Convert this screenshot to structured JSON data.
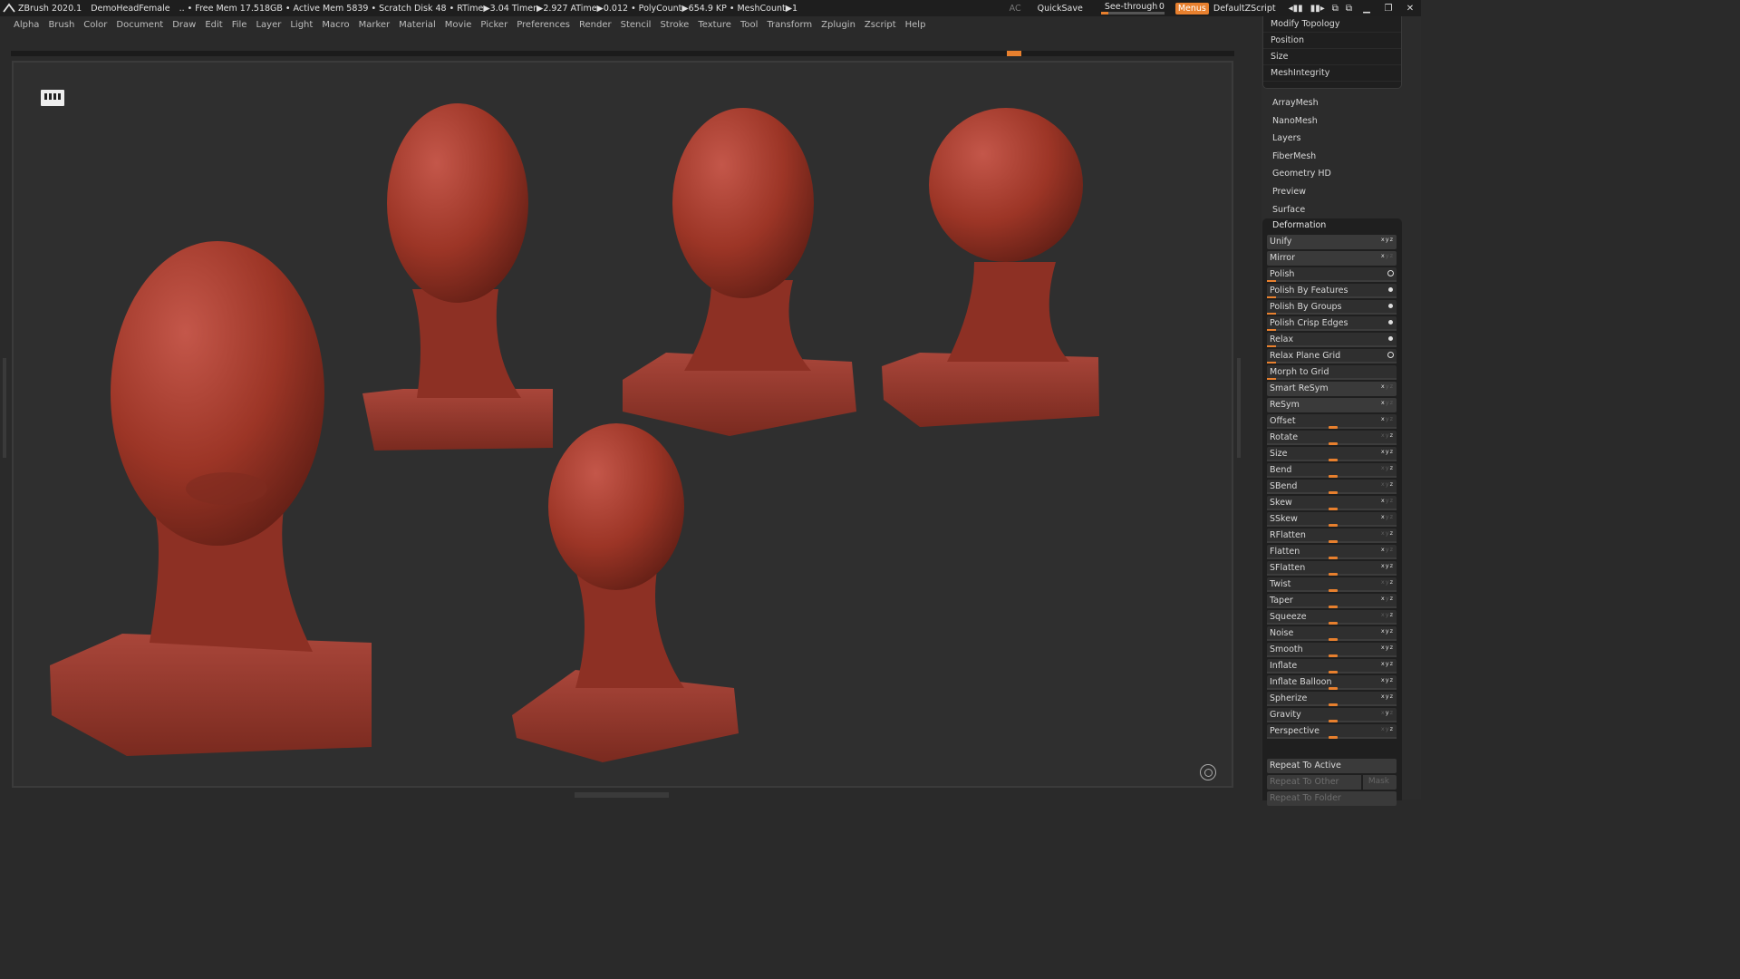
{
  "titlebar": {
    "app_name": "ZBrush 2020.1",
    "document": "DemoHeadFemale",
    "stats": "..  • Free Mem 17.518GB • Active Mem 5839 • Scratch Disk 48  • RTime▶3.04 Timer▶2.927 ATime▶0.012 • PolyCount▶654.9 KP  • MeshCount▶1",
    "ac": "AC",
    "quicksave": "QuickSave",
    "see_through_label": "See-through",
    "see_through_value": "0",
    "see_through_level": 0.0,
    "menus_label": "Menus",
    "script_label": "DefaultZScript"
  },
  "menubar": {
    "items": [
      "Alpha",
      "Brush",
      "Color",
      "Document",
      "Draw",
      "Edit",
      "File",
      "Layer",
      "Light",
      "Macro",
      "Marker",
      "Material",
      "Movie",
      "Picker",
      "Preferences",
      "Render",
      "Stencil",
      "Stroke",
      "Texture",
      "Tool",
      "Transform",
      "Zplugin",
      "Zscript",
      "Help"
    ]
  },
  "right_panel": {
    "top_group": [
      "Modify Topology",
      "Position",
      "Size",
      "MeshIntegrity"
    ],
    "subpalettes": [
      "ArrayMesh",
      "NanoMesh",
      "Layers",
      "FiberMesh",
      "Geometry HD",
      "Preview",
      "Surface"
    ],
    "deformation": {
      "title": "Deformation",
      "rows": [
        {
          "label": "Unify",
          "kind": "button",
          "xyz": [
            true,
            true,
            true
          ]
        },
        {
          "label": "Mirror",
          "kind": "button",
          "xyz": [
            true,
            false,
            false
          ]
        },
        {
          "label": "Polish",
          "kind": "slider",
          "value": 0.05,
          "icon": "circle"
        },
        {
          "label": "Polish By Features",
          "kind": "slider",
          "value": 0.05,
          "icon": "dot"
        },
        {
          "label": "Polish By Groups",
          "kind": "slider",
          "value": 0.05,
          "icon": "dot"
        },
        {
          "label": "Polish Crisp Edges",
          "kind": "slider",
          "value": 0.05,
          "icon": "dot"
        },
        {
          "label": "Relax",
          "kind": "slider",
          "value": 0.05,
          "icon": "dot"
        },
        {
          "label": "Relax Plane Grid",
          "kind": "slider",
          "value": 0.05,
          "icon": "circle"
        },
        {
          "label": "Morph to Grid",
          "kind": "slider",
          "value": 0.05
        },
        {
          "label": "Smart ReSym",
          "kind": "button",
          "xyz": [
            true,
            false,
            false
          ]
        },
        {
          "label": "ReSym",
          "kind": "button",
          "xyz": [
            true,
            false,
            false
          ]
        },
        {
          "label": "Offset",
          "kind": "center",
          "xyz": [
            true,
            false,
            false
          ]
        },
        {
          "label": "Rotate",
          "kind": "center",
          "xyz": [
            false,
            false,
            true
          ]
        },
        {
          "label": "Size",
          "kind": "center",
          "xyz": [
            true,
            true,
            true
          ]
        },
        {
          "label": "Bend",
          "kind": "center",
          "xyz": [
            false,
            false,
            true
          ]
        },
        {
          "label": "SBend",
          "kind": "center",
          "xyz": [
            false,
            false,
            true
          ]
        },
        {
          "label": "Skew",
          "kind": "center",
          "xyz": [
            true,
            false,
            false
          ]
        },
        {
          "label": "SSkew",
          "kind": "center",
          "xyz": [
            true,
            false,
            false
          ]
        },
        {
          "label": "RFlatten",
          "kind": "center",
          "xyz": [
            false,
            false,
            true
          ]
        },
        {
          "label": "Flatten",
          "kind": "center",
          "xyz": [
            true,
            false,
            false
          ]
        },
        {
          "label": "SFlatten",
          "kind": "center",
          "xyz": [
            true,
            true,
            true
          ]
        },
        {
          "label": "Twist",
          "kind": "center",
          "xyz": [
            false,
            false,
            true
          ]
        },
        {
          "label": "Taper",
          "kind": "center",
          "xyz": [
            true,
            false,
            true
          ]
        },
        {
          "label": "Squeeze",
          "kind": "center",
          "xyz": [
            false,
            false,
            true
          ]
        },
        {
          "label": "Noise",
          "kind": "center",
          "xyz": [
            true,
            true,
            true
          ]
        },
        {
          "label": "Smooth",
          "kind": "center",
          "xyz": [
            true,
            true,
            true
          ]
        },
        {
          "label": "Inflate",
          "kind": "center",
          "xyz": [
            true,
            true,
            true
          ]
        },
        {
          "label": "Inflate Balloon",
          "kind": "center",
          "xyz": [
            true,
            true,
            true
          ]
        },
        {
          "label": "Spherize",
          "kind": "center",
          "xyz": [
            true,
            true,
            true
          ]
        },
        {
          "label": "Gravity",
          "kind": "center",
          "xyz": [
            false,
            true,
            false
          ]
        },
        {
          "label": "Perspective",
          "kind": "center",
          "xyz": [
            false,
            false,
            true
          ]
        }
      ],
      "repeat_to_active": "Repeat To Active",
      "repeat_to_other": "Repeat To Other",
      "mask_label": "Mask",
      "repeat_to_folder": "Repeat To Folder"
    }
  },
  "colors": {
    "accent": "#e8802e",
    "sculpt": "#9c3526",
    "canvas": "#2f2f2f"
  }
}
